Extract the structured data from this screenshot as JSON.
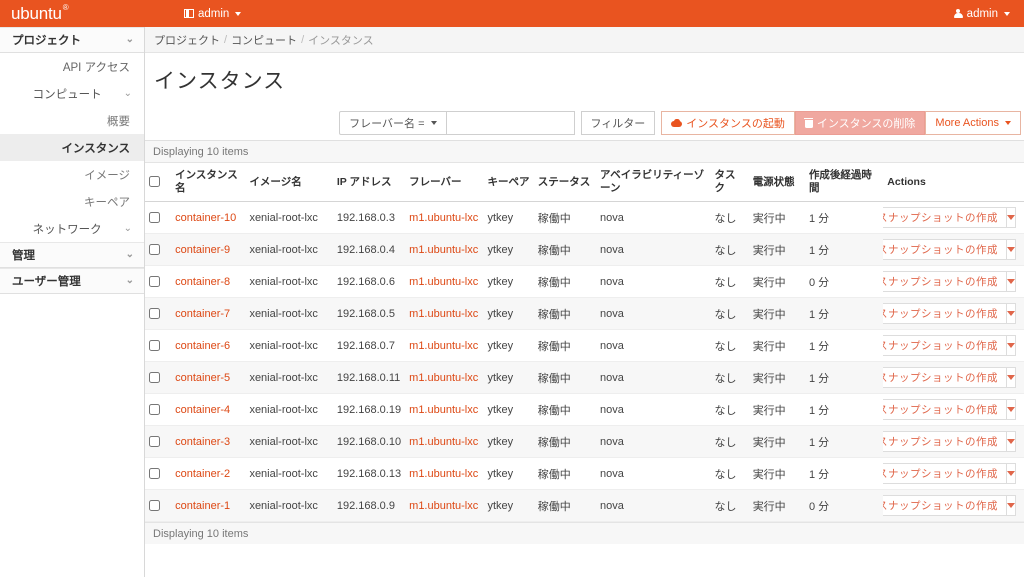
{
  "navbar": {
    "brand": "ubuntu",
    "brand_mark": "®",
    "project_menu": "admin",
    "user_menu": "admin"
  },
  "sidebar": {
    "project_group": "プロジェクト",
    "items": [
      {
        "label": "API アクセス",
        "type": "link",
        "active": false
      },
      {
        "label": "コンピュート",
        "type": "subhead",
        "expanded": true
      },
      {
        "label": "概要",
        "type": "link",
        "active": false
      },
      {
        "label": "インスタンス",
        "type": "link",
        "active": true
      },
      {
        "label": "イメージ",
        "type": "link",
        "active": false
      },
      {
        "label": "キーペア",
        "type": "link",
        "active": false
      },
      {
        "label": "ネットワーク",
        "type": "subhead",
        "expanded": false
      }
    ],
    "admin_group": "管理",
    "identity_group": "ユーザー管理"
  },
  "breadcrumb": {
    "items": [
      "プロジェクト",
      "コンピュート",
      "インスタンス"
    ],
    "separator": "/"
  },
  "page": {
    "title": "インスタンス"
  },
  "toolbar": {
    "filter_select": "フレーバー名 =",
    "filter_placeholder": "",
    "filter_value": "",
    "filter_button": "フィルター",
    "launch_button": "インスタンスの起動",
    "delete_button": "インスタンスの削除",
    "more_actions": "More Actions"
  },
  "table": {
    "count_top": "Displaying 10 items",
    "count_bottom": "Displaying 10 items",
    "columns": [
      "インスタンス名",
      "イメージ名",
      "IP アドレス",
      "フレーバー",
      "キーペア",
      "ステータス",
      "アベイラビリティーゾーン",
      "タスク",
      "電源状態",
      "作成後経過時間",
      "Actions"
    ],
    "action_label": "スナップショットの作成",
    "rows": [
      {
        "name": "container-10",
        "image": "xenial-root-lxc",
        "ip": "192.168.0.3",
        "flavor": "m1.ubuntu-lxc",
        "keypair": "ytkey",
        "status": "稼働中",
        "az": "nova",
        "task": "なし",
        "power": "実行中",
        "uptime": "1 分"
      },
      {
        "name": "container-9",
        "image": "xenial-root-lxc",
        "ip": "192.168.0.4",
        "flavor": "m1.ubuntu-lxc",
        "keypair": "ytkey",
        "status": "稼働中",
        "az": "nova",
        "task": "なし",
        "power": "実行中",
        "uptime": "1 分"
      },
      {
        "name": "container-8",
        "image": "xenial-root-lxc",
        "ip": "192.168.0.6",
        "flavor": "m1.ubuntu-lxc",
        "keypair": "ytkey",
        "status": "稼働中",
        "az": "nova",
        "task": "なし",
        "power": "実行中",
        "uptime": "0 分"
      },
      {
        "name": "container-7",
        "image": "xenial-root-lxc",
        "ip": "192.168.0.5",
        "flavor": "m1.ubuntu-lxc",
        "keypair": "ytkey",
        "status": "稼働中",
        "az": "nova",
        "task": "なし",
        "power": "実行中",
        "uptime": "1 分"
      },
      {
        "name": "container-6",
        "image": "xenial-root-lxc",
        "ip": "192.168.0.7",
        "flavor": "m1.ubuntu-lxc",
        "keypair": "ytkey",
        "status": "稼働中",
        "az": "nova",
        "task": "なし",
        "power": "実行中",
        "uptime": "1 分"
      },
      {
        "name": "container-5",
        "image": "xenial-root-lxc",
        "ip": "192.168.0.11",
        "flavor": "m1.ubuntu-lxc",
        "keypair": "ytkey",
        "status": "稼働中",
        "az": "nova",
        "task": "なし",
        "power": "実行中",
        "uptime": "1 分"
      },
      {
        "name": "container-4",
        "image": "xenial-root-lxc",
        "ip": "192.168.0.19",
        "flavor": "m1.ubuntu-lxc",
        "keypair": "ytkey",
        "status": "稼働中",
        "az": "nova",
        "task": "なし",
        "power": "実行中",
        "uptime": "1 分"
      },
      {
        "name": "container-3",
        "image": "xenial-root-lxc",
        "ip": "192.168.0.10",
        "flavor": "m1.ubuntu-lxc",
        "keypair": "ytkey",
        "status": "稼働中",
        "az": "nova",
        "task": "なし",
        "power": "実行中",
        "uptime": "1 分"
      },
      {
        "name": "container-2",
        "image": "xenial-root-lxc",
        "ip": "192.168.0.13",
        "flavor": "m1.ubuntu-lxc",
        "keypair": "ytkey",
        "status": "稼働中",
        "az": "nova",
        "task": "なし",
        "power": "実行中",
        "uptime": "1 分"
      },
      {
        "name": "container-1",
        "image": "xenial-root-lxc",
        "ip": "192.168.0.9",
        "flavor": "m1.ubuntu-lxc",
        "keypair": "ytkey",
        "status": "稼働中",
        "az": "nova",
        "task": "なし",
        "power": "実行中",
        "uptime": "0 分"
      }
    ]
  },
  "colors": {
    "brand_orange": "#e95420",
    "link_orange": "#dd4814",
    "danger_bg": "#f0a8a0"
  }
}
